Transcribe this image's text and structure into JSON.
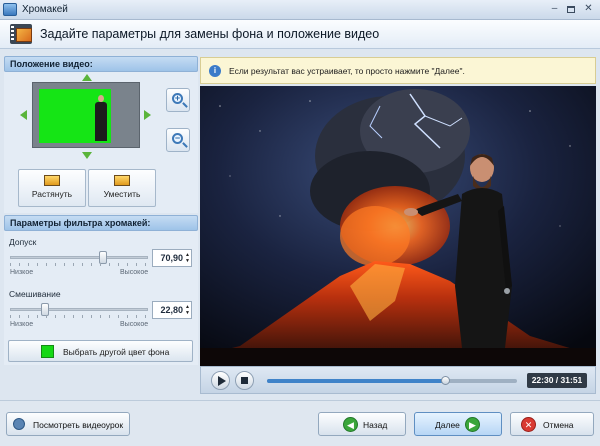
{
  "window": {
    "title": "Хромакей",
    "controls": {
      "minimize": "–",
      "close": "✕"
    }
  },
  "header": {
    "title": "Задайте параметры для замены фона и положение видео",
    "icon": "film-icon"
  },
  "position_section": {
    "title": "Положение видео:",
    "stretch_label": "Растянуть",
    "fit_label": "Уместить",
    "zoom_in_glyph": "+",
    "zoom_out_glyph": "−"
  },
  "filter_section": {
    "title": "Параметры фильтра хромакей:",
    "tolerance": {
      "label": "Допуск",
      "value": "70,90",
      "scale_low": "Низкое",
      "scale_high": "Высокое",
      "slider_fraction": 0.68
    },
    "blending": {
      "label": "Смешивание",
      "value": "22,80",
      "scale_low": "Низкое",
      "scale_high": "Высокое",
      "slider_fraction": 0.23
    },
    "color_button_label": "Выбрать другой цвет фона",
    "key_color": "#15d815"
  },
  "info": {
    "icon": "i",
    "text": "Если результат вас устраивает, то просто нажмите \"Далее\"."
  },
  "player": {
    "time": "22:30 / 31:51",
    "progress_fraction": 0.71
  },
  "footer": {
    "tutorial_label": "Посмотреть видеоурок",
    "back_label": "Назад",
    "back_glyph": "◀",
    "next_label": "Далее",
    "next_glyph": "▶",
    "cancel_label": "Отмена",
    "cancel_glyph": "✕"
  },
  "colors": {
    "accent": "#3f83c9",
    "section_head": "#b1cfee",
    "chroma_green": "#15e515"
  }
}
